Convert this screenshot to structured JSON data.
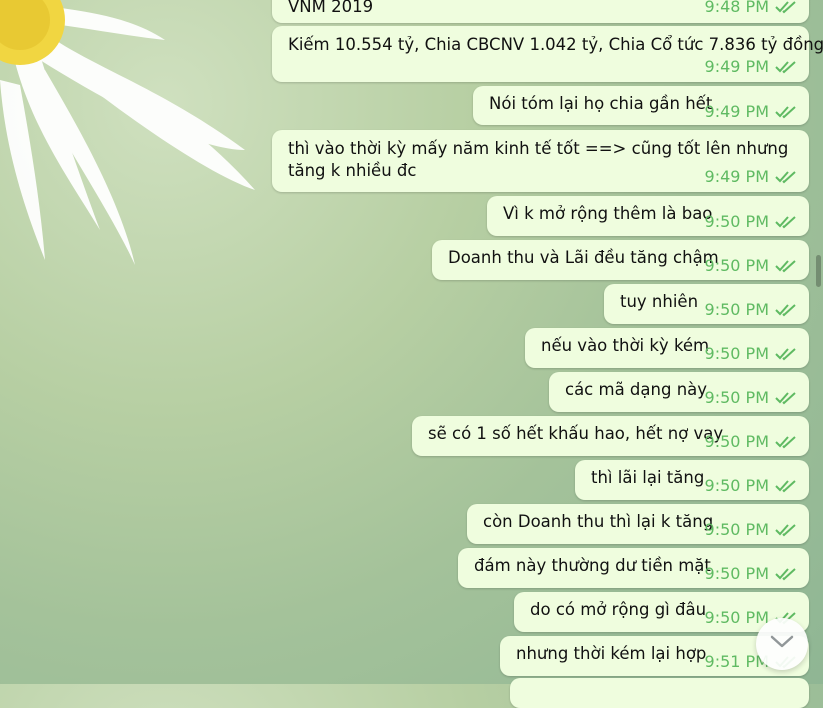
{
  "colors": {
    "bubble": "#effdde",
    "time_and_check": "#5fba62"
  },
  "messages": [
    {
      "text": "VNM 2019",
      "time": "9:48 PM",
      "icon": "double-check-icon"
    },
    {
      "text": "Kiếm 10.554 tỷ, Chia CBCNV 1.042 tỷ, Chia Cổ tức 7.836 tỷ đồng",
      "time": "9:49 PM",
      "icon": "double-check-icon"
    },
    {
      "text": "Nói tóm lại họ chia gần hết",
      "time": "9:49 PM",
      "icon": "double-check-icon"
    },
    {
      "text": "thì vào thời kỳ mấy năm kinh tế tốt ==> cũng tốt lên nhưng tăng k nhiều đc",
      "time": "9:49 PM",
      "icon": "double-check-icon"
    },
    {
      "text": "Vì k mở rộng thêm là bao",
      "time": "9:50 PM",
      "icon": "double-check-icon"
    },
    {
      "text": "Doanh thu và Lãi đều tăng chậm",
      "time": "9:50 PM",
      "icon": "double-check-icon"
    },
    {
      "text": "tuy nhiên",
      "time": "9:50 PM",
      "icon": "double-check-icon"
    },
    {
      "text": "nếu vào thời kỳ kém",
      "time": "9:50 PM",
      "icon": "double-check-icon"
    },
    {
      "text": "các mã dạng này",
      "time": "9:50 PM",
      "icon": "double-check-icon"
    },
    {
      "text": "sẽ có 1 số hết khấu hao, hết nợ vay",
      "time": "9:50 PM",
      "icon": "double-check-icon"
    },
    {
      "text": "thì lãi lại tăng",
      "time": "9:50 PM",
      "icon": "double-check-icon"
    },
    {
      "text": "còn Doanh thu thì lại k tăng",
      "time": "9:50 PM",
      "icon": "double-check-icon"
    },
    {
      "text": "đám này thường dư tiền mặt",
      "time": "9:50 PM",
      "icon": "double-check-icon"
    },
    {
      "text": "do có mở rộng gì đâu",
      "time": "9:50 PM",
      "icon": "double-check-icon"
    },
    {
      "text": "nhưng thời kém lại hợp",
      "time": "9:51 PM",
      "icon": "double-check-icon"
    }
  ],
  "scroll_button": {
    "icon": "chevron-down-icon"
  }
}
